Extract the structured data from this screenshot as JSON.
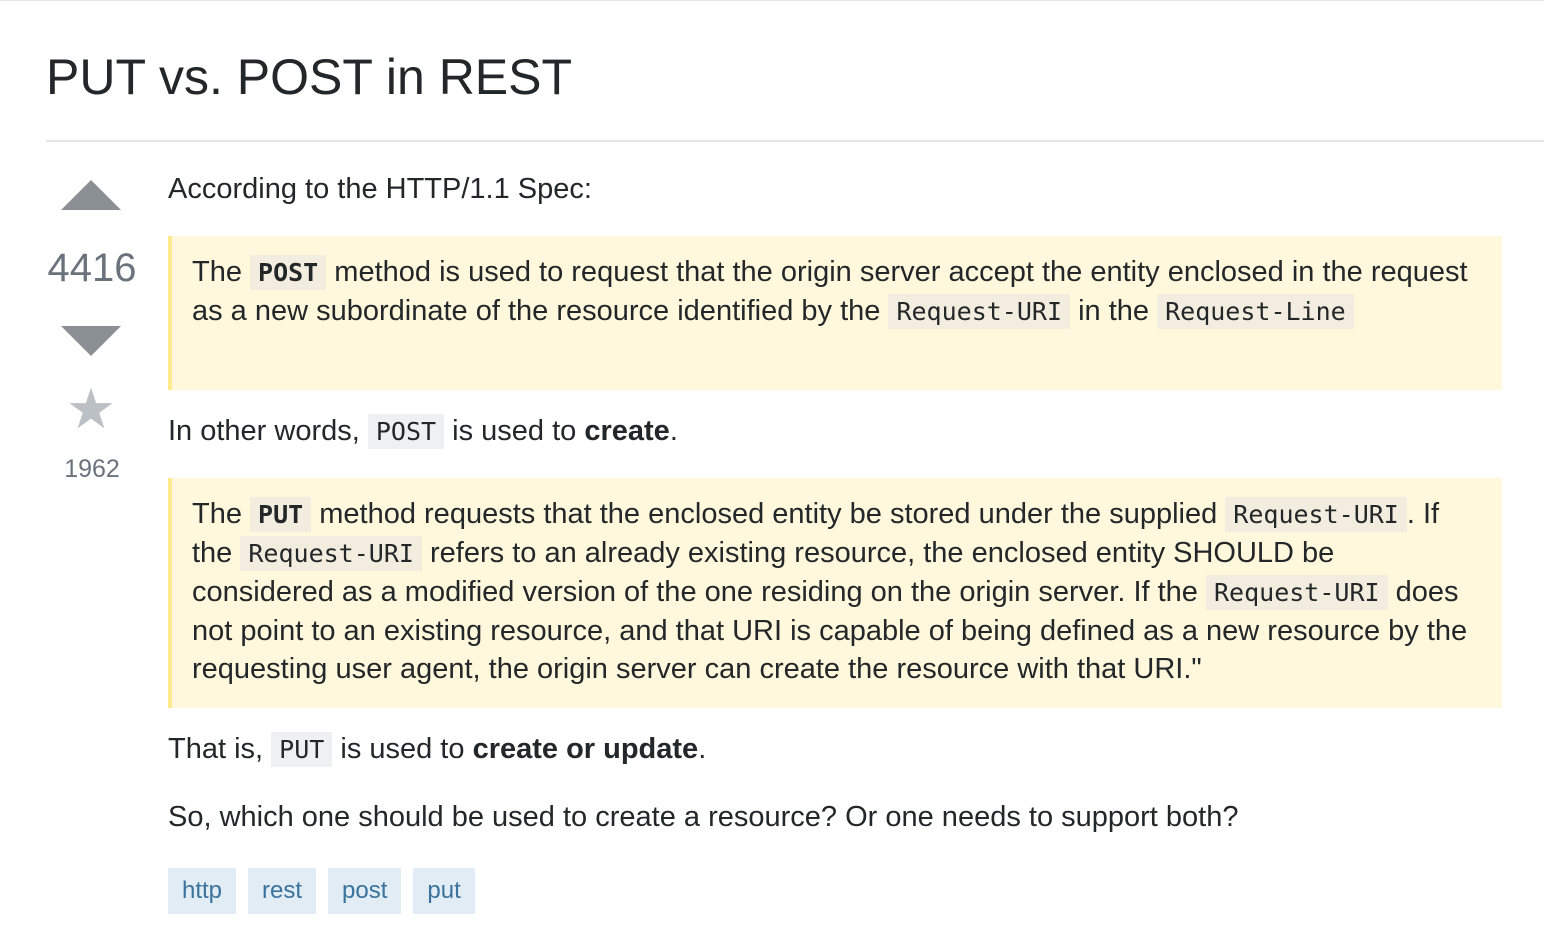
{
  "question": {
    "title": "PUT vs. POST in REST"
  },
  "votes": {
    "score": "4416",
    "favorites": "1962"
  },
  "body": {
    "intro": "According to the HTTP/1.1 Spec:",
    "quote1": {
      "t1": "The ",
      "code1": "POST",
      "t2": " method is used to request that the origin server accept the entity enclosed in the request as a new subordinate of the resource identified by the ",
      "code2": "Request-URI",
      "t3": " in the ",
      "code3": "Request-Line"
    },
    "para2": {
      "t1": "In other words, ",
      "code": "POST",
      "t2": " is used to ",
      "bold": "create",
      "t3": "."
    },
    "quote2": {
      "t1": "The ",
      "code1": "PUT",
      "t2": " method requests that the enclosed entity be stored under the supplied ",
      "code2": "Request-URI",
      "t3": ". If the ",
      "code3": "Request-URI",
      "t4": " refers to an already existing resource, the enclosed entity SHOULD be considered as a modified version of the one residing on the origin server. If the ",
      "code4": "Request-URI",
      "t5": " does not point to an existing resource, and that URI is capable of being defined as a new resource by the requesting user agent, the origin server can create the resource with that URI.\""
    },
    "para3": {
      "t1": "That is, ",
      "code": "PUT",
      "t2": " is used to ",
      "bold": "create or update",
      "t3": "."
    },
    "para4": "So, which one should be used to create a resource? Or one needs to support both?"
  },
  "tags": [
    "http",
    "rest",
    "post",
    "put"
  ],
  "colors": {
    "quote_bg": "#fff8dc",
    "quote_border": "#ffeb8e",
    "tag_bg": "#e1ecf4",
    "tag_text": "#39739d",
    "vote_arrow": "#8a9094"
  },
  "icons": {
    "upvote": "triangle-up",
    "downvote": "triangle-down",
    "favorite": "star"
  }
}
